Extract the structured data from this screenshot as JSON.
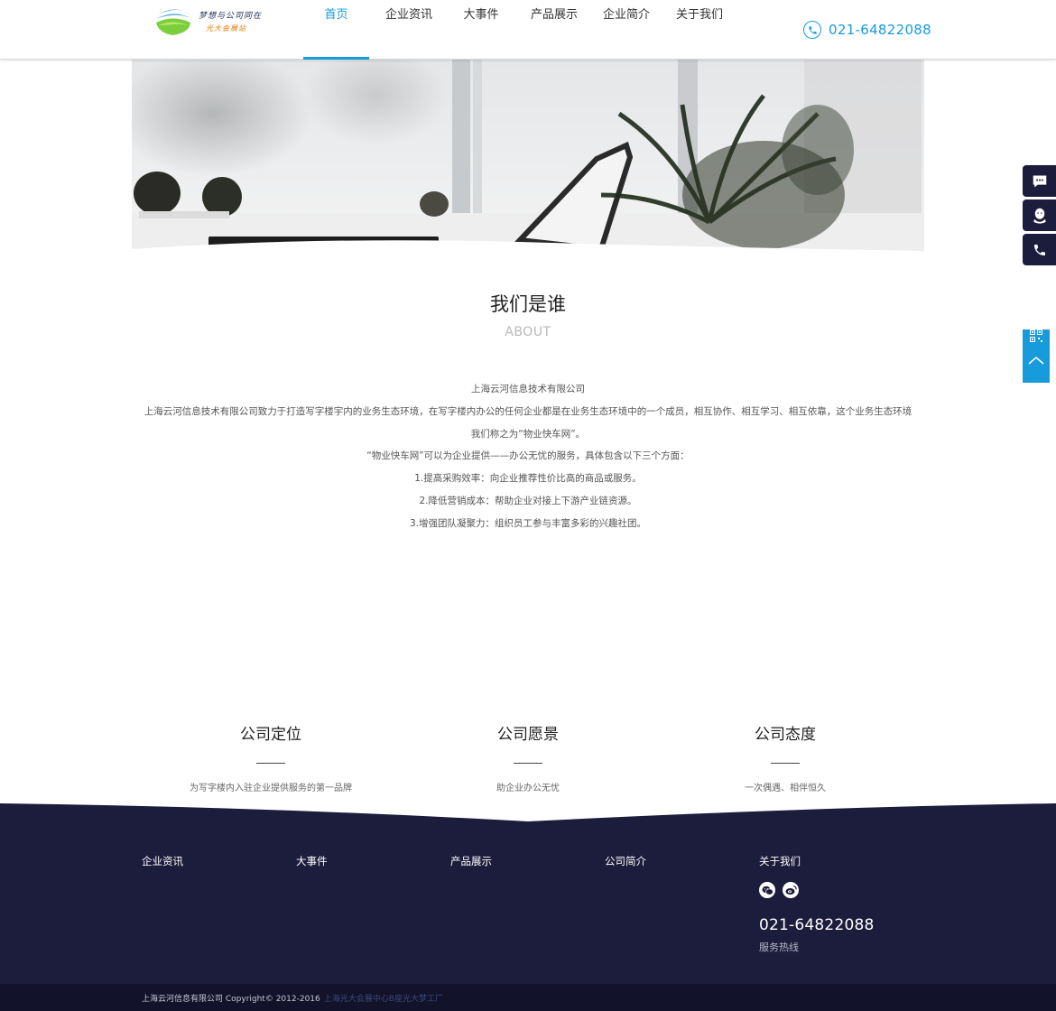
{
  "logo": {
    "line1": "梦想与公司同在",
    "line2": "光大会展站"
  },
  "nav": {
    "items": [
      {
        "label": "首页",
        "active": true
      },
      {
        "label": "企业资讯",
        "active": false
      },
      {
        "label": "大事件",
        "active": false
      },
      {
        "label": "产品展示",
        "active": false
      },
      {
        "label": "企业简介",
        "active": false
      },
      {
        "label": "关于我们",
        "active": false
      }
    ]
  },
  "header": {
    "phone": "021-64822088",
    "phone_icon": "phone-icon"
  },
  "about": {
    "title": "我们是谁",
    "subtitle": "ABOUT",
    "paragraphs": [
      "上海云河信息技术有限公司",
      "上海云河信息技术有限公司致力于打造写字楼宇内的业务生态环境，在写字楼内办公的任何企业都是在业务生态环境中的一个成员，相互协作、相互学习、相互依靠，这个业务生态环境我们称之为“物业快车网”。",
      "“物业快车网”可以为企业提供——办公无忧的服务，具体包含以下三个方面：",
      "1.提高采购效率：向企业推荐性价比高的商品或服务。",
      "2.降低营销成本：帮助企业对接上下游产业链资源。",
      "3.增强团队凝聚力：组织员工参与丰富多彩的兴趣社团。"
    ]
  },
  "features": [
    {
      "title": "公司定位",
      "text": "为写字楼内入驻企业提供服务的第一品牌"
    },
    {
      "title": "公司愿景",
      "text": "助企业办公无忧"
    },
    {
      "title": "公司态度",
      "text": "一次偶遇、相伴恒久"
    }
  ],
  "footer": {
    "columns": [
      "企业资讯",
      "大事件",
      "产品展示",
      "公司简介",
      "关于我们"
    ],
    "social_icons": [
      "wechat-icon",
      "weibo-icon"
    ],
    "phone": "021-64822088",
    "phone_label": "服务热线",
    "copyright": "上海云河信息有限公司 Copyright© 2012-2016",
    "address": "上海光大会展中心B座光大梦工厂"
  },
  "float_bar": [
    "message-icon",
    "qq-icon",
    "phone-icon",
    "qrcode-icon",
    "back-to-top-icon"
  ],
  "colors": {
    "accent": "#179bdb",
    "footer_bg": "#1c1c3c",
    "copy_bg": "#12122a"
  }
}
